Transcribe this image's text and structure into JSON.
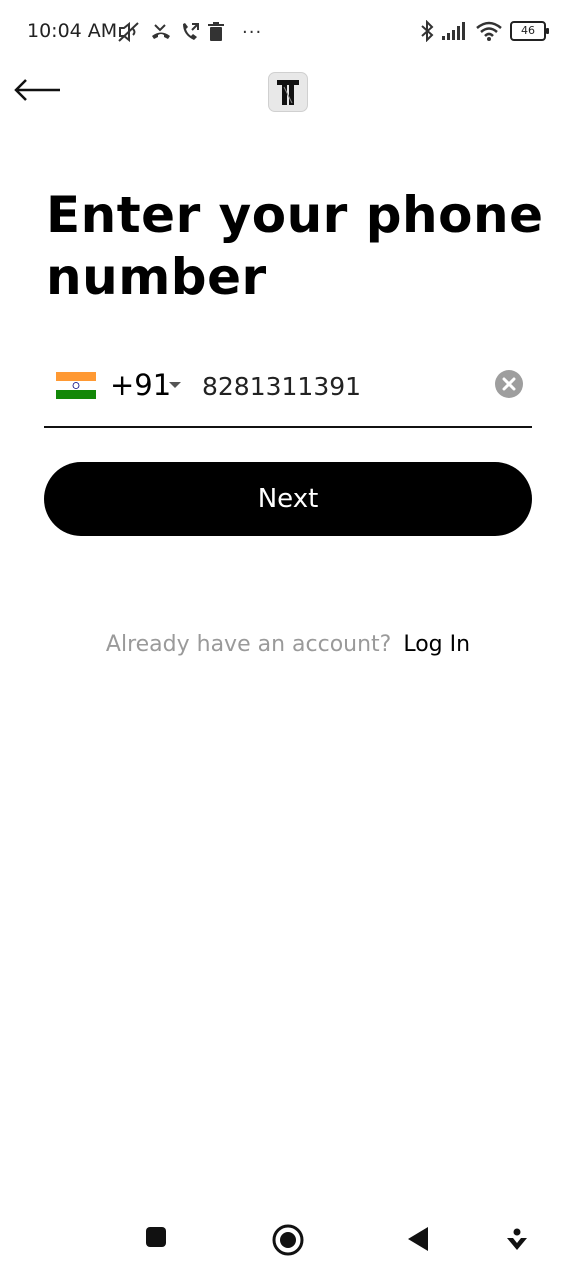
{
  "status_bar": {
    "time": "10:04 AM",
    "battery_level": "46",
    "overflow": "···",
    "left_icons": [
      "mute-icon",
      "missed-call-icon",
      "call-forward-icon",
      "trash-icon"
    ],
    "right_icons": [
      "bluetooth-icon",
      "signal-icon",
      "wifi-icon",
      "battery-icon"
    ]
  },
  "header": {
    "back_icon": "arrow-left-icon",
    "logo_icon": "app-logo"
  },
  "main": {
    "title": "Enter your phone number",
    "phone": {
      "country_flag": "india-flag",
      "country_code": "+91",
      "number": "8281311391",
      "clear_icon": "clear-icon"
    },
    "next_label": "Next",
    "login_prompt": "Already have an account?",
    "login_link": "Log In"
  },
  "colors": {
    "primary": "#000000",
    "button_text": "#ffffff",
    "muted_text": "#9a9a9a",
    "flag_saffron": "#ff9933",
    "flag_green": "#138808",
    "chakra_blue": "#000080"
  },
  "nav_bar": {
    "items": [
      "recents-icon",
      "home-icon",
      "back-icon",
      "assistant-icon"
    ]
  }
}
